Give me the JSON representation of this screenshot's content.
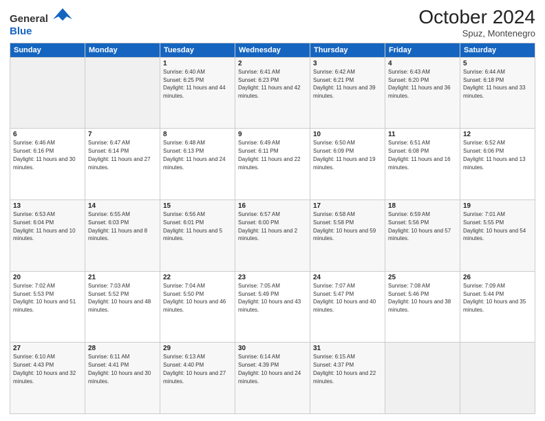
{
  "header": {
    "logo_general": "General",
    "logo_blue": "Blue",
    "month": "October 2024",
    "location": "Spuz, Montenegro"
  },
  "days_of_week": [
    "Sunday",
    "Monday",
    "Tuesday",
    "Wednesday",
    "Thursday",
    "Friday",
    "Saturday"
  ],
  "weeks": [
    [
      {
        "day": "",
        "sunrise": "",
        "sunset": "",
        "daylight": "",
        "empty": true
      },
      {
        "day": "",
        "sunrise": "",
        "sunset": "",
        "daylight": "",
        "empty": true
      },
      {
        "day": "1",
        "sunrise": "Sunrise: 6:40 AM",
        "sunset": "Sunset: 6:25 PM",
        "daylight": "Daylight: 11 hours and 44 minutes."
      },
      {
        "day": "2",
        "sunrise": "Sunrise: 6:41 AM",
        "sunset": "Sunset: 6:23 PM",
        "daylight": "Daylight: 11 hours and 42 minutes."
      },
      {
        "day": "3",
        "sunrise": "Sunrise: 6:42 AM",
        "sunset": "Sunset: 6:21 PM",
        "daylight": "Daylight: 11 hours and 39 minutes."
      },
      {
        "day": "4",
        "sunrise": "Sunrise: 6:43 AM",
        "sunset": "Sunset: 6:20 PM",
        "daylight": "Daylight: 11 hours and 36 minutes."
      },
      {
        "day": "5",
        "sunrise": "Sunrise: 6:44 AM",
        "sunset": "Sunset: 6:18 PM",
        "daylight": "Daylight: 11 hours and 33 minutes."
      }
    ],
    [
      {
        "day": "6",
        "sunrise": "Sunrise: 6:46 AM",
        "sunset": "Sunset: 6:16 PM",
        "daylight": "Daylight: 11 hours and 30 minutes."
      },
      {
        "day": "7",
        "sunrise": "Sunrise: 6:47 AM",
        "sunset": "Sunset: 6:14 PM",
        "daylight": "Daylight: 11 hours and 27 minutes."
      },
      {
        "day": "8",
        "sunrise": "Sunrise: 6:48 AM",
        "sunset": "Sunset: 6:13 PM",
        "daylight": "Daylight: 11 hours and 24 minutes."
      },
      {
        "day": "9",
        "sunrise": "Sunrise: 6:49 AM",
        "sunset": "Sunset: 6:11 PM",
        "daylight": "Daylight: 11 hours and 22 minutes."
      },
      {
        "day": "10",
        "sunrise": "Sunrise: 6:50 AM",
        "sunset": "Sunset: 6:09 PM",
        "daylight": "Daylight: 11 hours and 19 minutes."
      },
      {
        "day": "11",
        "sunrise": "Sunrise: 6:51 AM",
        "sunset": "Sunset: 6:08 PM",
        "daylight": "Daylight: 11 hours and 16 minutes."
      },
      {
        "day": "12",
        "sunrise": "Sunrise: 6:52 AM",
        "sunset": "Sunset: 6:06 PM",
        "daylight": "Daylight: 11 hours and 13 minutes."
      }
    ],
    [
      {
        "day": "13",
        "sunrise": "Sunrise: 6:53 AM",
        "sunset": "Sunset: 6:04 PM",
        "daylight": "Daylight: 11 hours and 10 minutes."
      },
      {
        "day": "14",
        "sunrise": "Sunrise: 6:55 AM",
        "sunset": "Sunset: 6:03 PM",
        "daylight": "Daylight: 11 hours and 8 minutes."
      },
      {
        "day": "15",
        "sunrise": "Sunrise: 6:56 AM",
        "sunset": "Sunset: 6:01 PM",
        "daylight": "Daylight: 11 hours and 5 minutes."
      },
      {
        "day": "16",
        "sunrise": "Sunrise: 6:57 AM",
        "sunset": "Sunset: 6:00 PM",
        "daylight": "Daylight: 11 hours and 2 minutes."
      },
      {
        "day": "17",
        "sunrise": "Sunrise: 6:58 AM",
        "sunset": "Sunset: 5:58 PM",
        "daylight": "Daylight: 10 hours and 59 minutes."
      },
      {
        "day": "18",
        "sunrise": "Sunrise: 6:59 AM",
        "sunset": "Sunset: 5:56 PM",
        "daylight": "Daylight: 10 hours and 57 minutes."
      },
      {
        "day": "19",
        "sunrise": "Sunrise: 7:01 AM",
        "sunset": "Sunset: 5:55 PM",
        "daylight": "Daylight: 10 hours and 54 minutes."
      }
    ],
    [
      {
        "day": "20",
        "sunrise": "Sunrise: 7:02 AM",
        "sunset": "Sunset: 5:53 PM",
        "daylight": "Daylight: 10 hours and 51 minutes."
      },
      {
        "day": "21",
        "sunrise": "Sunrise: 7:03 AM",
        "sunset": "Sunset: 5:52 PM",
        "daylight": "Daylight: 10 hours and 48 minutes."
      },
      {
        "day": "22",
        "sunrise": "Sunrise: 7:04 AM",
        "sunset": "Sunset: 5:50 PM",
        "daylight": "Daylight: 10 hours and 46 minutes."
      },
      {
        "day": "23",
        "sunrise": "Sunrise: 7:05 AM",
        "sunset": "Sunset: 5:49 PM",
        "daylight": "Daylight: 10 hours and 43 minutes."
      },
      {
        "day": "24",
        "sunrise": "Sunrise: 7:07 AM",
        "sunset": "Sunset: 5:47 PM",
        "daylight": "Daylight: 10 hours and 40 minutes."
      },
      {
        "day": "25",
        "sunrise": "Sunrise: 7:08 AM",
        "sunset": "Sunset: 5:46 PM",
        "daylight": "Daylight: 10 hours and 38 minutes."
      },
      {
        "day": "26",
        "sunrise": "Sunrise: 7:09 AM",
        "sunset": "Sunset: 5:44 PM",
        "daylight": "Daylight: 10 hours and 35 minutes."
      }
    ],
    [
      {
        "day": "27",
        "sunrise": "Sunrise: 6:10 AM",
        "sunset": "Sunset: 4:43 PM",
        "daylight": "Daylight: 10 hours and 32 minutes."
      },
      {
        "day": "28",
        "sunrise": "Sunrise: 6:11 AM",
        "sunset": "Sunset: 4:41 PM",
        "daylight": "Daylight: 10 hours and 30 minutes."
      },
      {
        "day": "29",
        "sunrise": "Sunrise: 6:13 AM",
        "sunset": "Sunset: 4:40 PM",
        "daylight": "Daylight: 10 hours and 27 minutes."
      },
      {
        "day": "30",
        "sunrise": "Sunrise: 6:14 AM",
        "sunset": "Sunset: 4:39 PM",
        "daylight": "Daylight: 10 hours and 24 minutes."
      },
      {
        "day": "31",
        "sunrise": "Sunrise: 6:15 AM",
        "sunset": "Sunset: 4:37 PM",
        "daylight": "Daylight: 10 hours and 22 minutes."
      },
      {
        "day": "",
        "sunrise": "",
        "sunset": "",
        "daylight": "",
        "empty": true
      },
      {
        "day": "",
        "sunrise": "",
        "sunset": "",
        "daylight": "",
        "empty": true
      }
    ]
  ]
}
